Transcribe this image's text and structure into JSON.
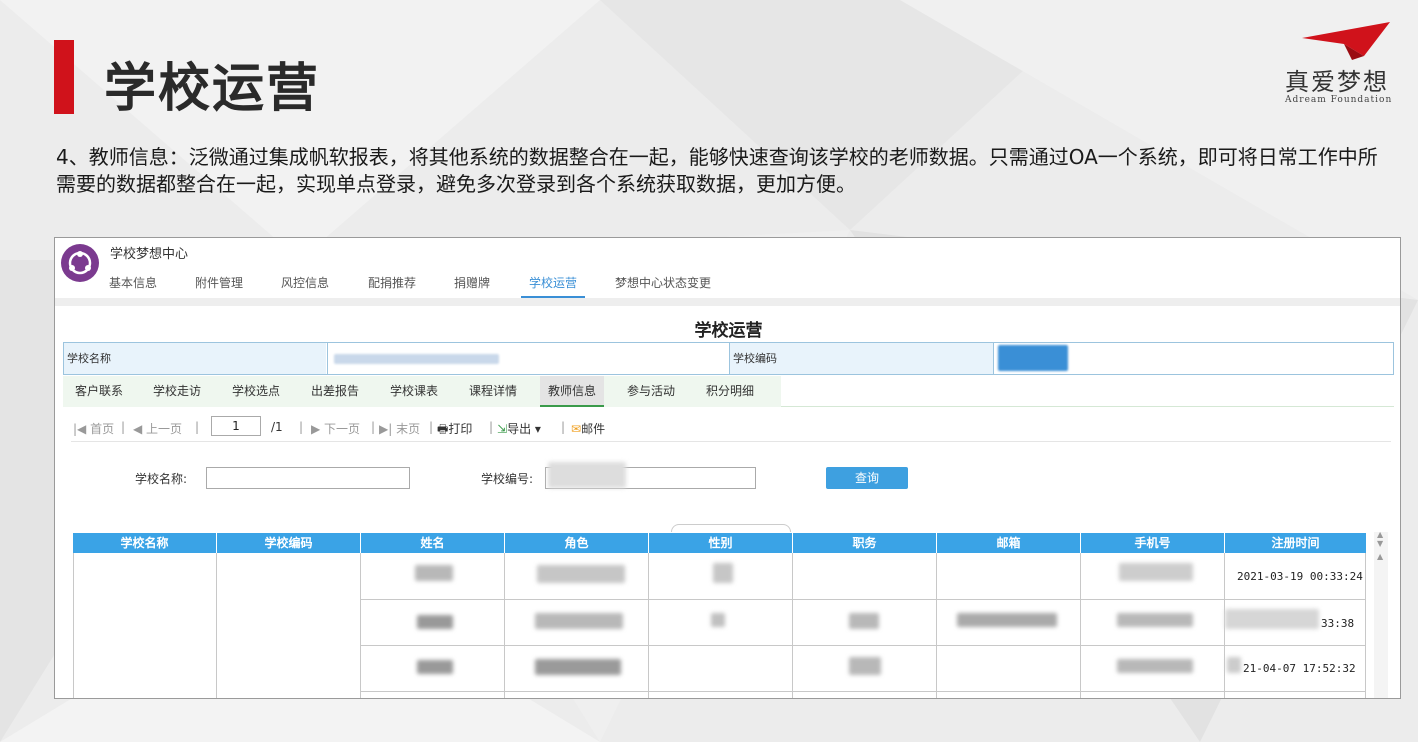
{
  "slide": {
    "title": "学校运营",
    "logo_cn": "真爱梦想",
    "logo_en": "Adream Foundation",
    "description": "4、教师信息：泛微通过集成帆软报表，将其他系统的数据整合在一起，能够快速查询该学校的老师数据。只需通过OA一个系统，即可将日常工作中所需要的数据都整合在一起，实现单点登录，避免多次登录到各个系统获取数据，更加方便。",
    "accent": "#d0121b"
  },
  "app": {
    "name": "学校梦想中心",
    "nav": [
      "基本信息",
      "附件管理",
      "风控信息",
      "配捐推荐",
      "捐赠牌",
      "学校运营",
      "梦想中心状态变更"
    ],
    "active_nav": "学校运营"
  },
  "form": {
    "title": "学校运营",
    "school_name_label": "学校名称",
    "school_code_label": "学校编码"
  },
  "subtabs": {
    "items": [
      "客户联系",
      "学校走访",
      "学校选点",
      "出差报告",
      "学校课表",
      "课程详情",
      "教师信息",
      "参与活动",
      "积分明细"
    ],
    "active": "教师信息"
  },
  "toolbar": {
    "first": "首页",
    "prev": "上一页",
    "page": "1",
    "total": "/1",
    "next": "下一页",
    "last": "末页",
    "print": "打印",
    "export": "导出",
    "mail": "邮件"
  },
  "search": {
    "school_name_label": "学校名称:",
    "school_code_label": "学校编号:",
    "query_button": "查询"
  },
  "table": {
    "columns": [
      "学校名称",
      "学校编码",
      "姓名",
      "角色",
      "性别",
      "职务",
      "邮箱",
      "手机号",
      "注册时间"
    ],
    "rows": [
      {
        "register_time": "2021-03-19 00:33:24"
      },
      {
        "register_time": "33:38"
      },
      {
        "register_time": "21-04-07 17:52:32"
      }
    ]
  }
}
